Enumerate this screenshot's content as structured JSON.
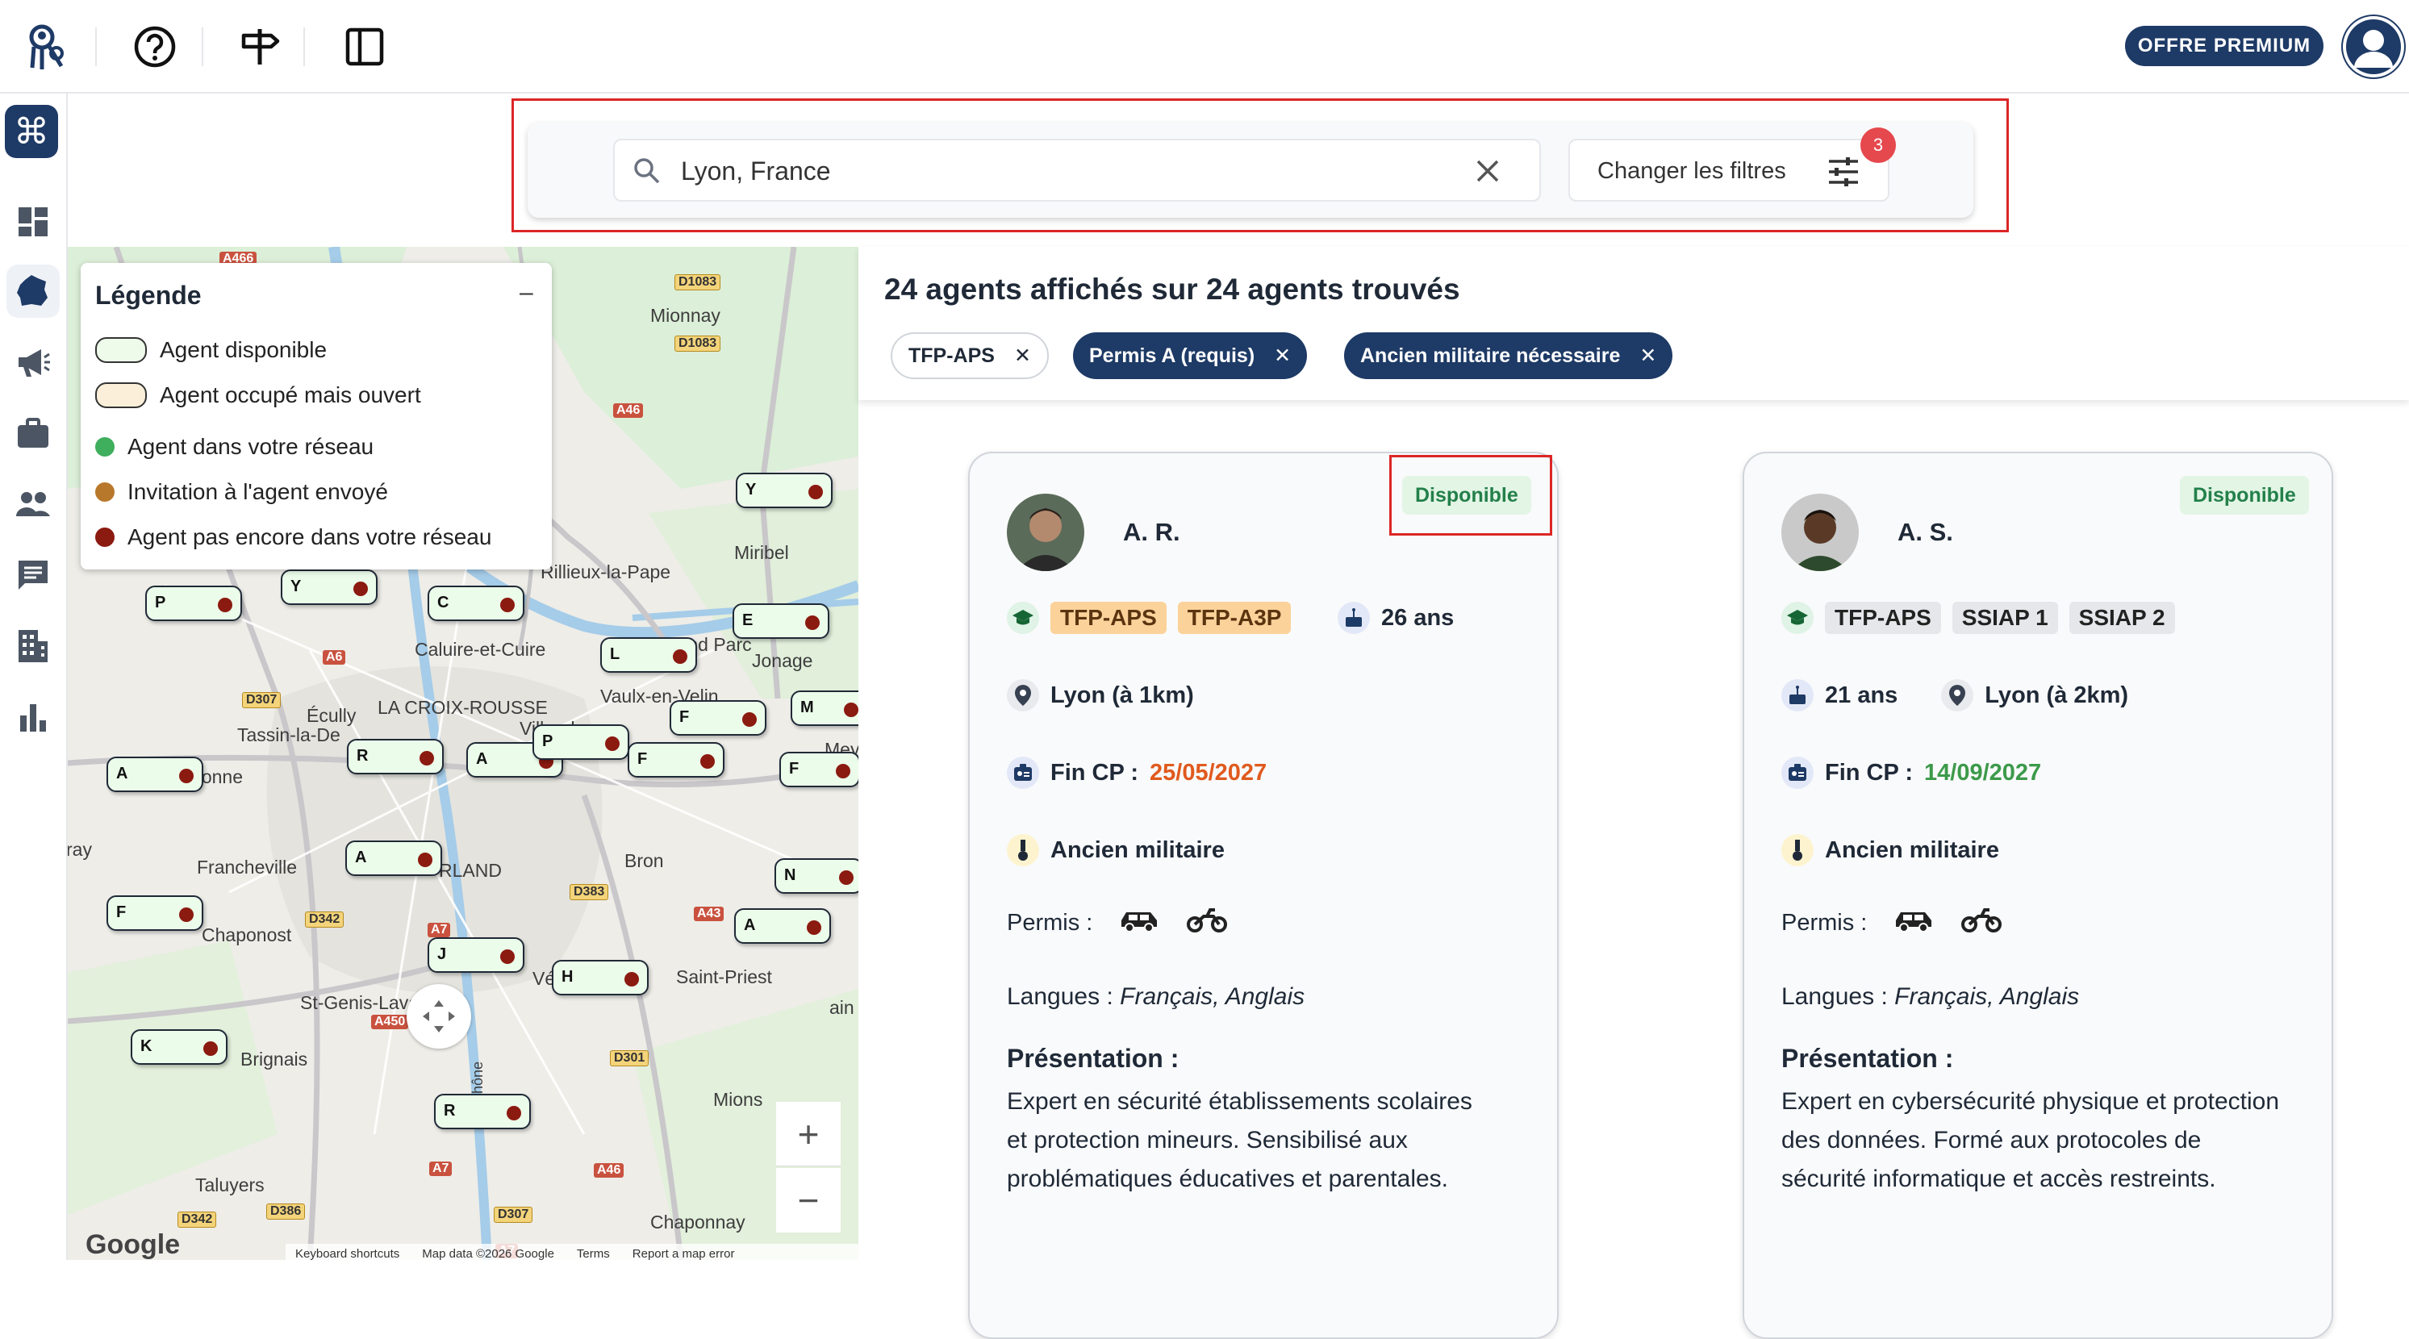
{
  "topbar": {
    "premium_label": "OFFRE PREMIUM"
  },
  "search": {
    "value": "Lyon, France",
    "filter_label": "Changer les filtres",
    "filter_count": "3"
  },
  "legend": {
    "title": "Légende",
    "collapse": "–",
    "items": [
      {
        "label": "Agent disponible",
        "color": "#eefbea"
      },
      {
        "label": "Agent occupé mais ouvert",
        "color": "#fcefd9"
      },
      {
        "label": "Agent dans votre réseau",
        "color": "#3fae5d"
      },
      {
        "label": "Invitation à l'agent envoyé",
        "color": "#b8782b"
      },
      {
        "label": "Agent pas encore dans votre réseau",
        "color": "#8b1a10"
      }
    ]
  },
  "map": {
    "places": [
      "Mionnay",
      "Miribel",
      "Rillieux-la-Pape",
      "Caluire-et-Cuire",
      "Grand Parc",
      "Jonage",
      "Vaulx-en-Velin",
      "LA CROIX-ROUSSE",
      "Écully",
      "Tassin-la-De",
      "Villeurbanne",
      "Craponne",
      "Bron",
      "Francheville",
      "Chaponost",
      "Saint-Priest",
      "St-Genis-Laval",
      "Brignais",
      "Mions",
      "Taluyers",
      "Chaponnay",
      "ray",
      "Vé",
      "Mey",
      "ain",
      "RLAND",
      "Rhône"
    ],
    "roads": [
      "A466",
      "D1083",
      "D1083",
      "A46",
      "A6",
      "D307",
      "D383",
      "A43",
      "D342",
      "A450",
      "A7",
      "D301",
      "A7",
      "A46",
      "D342",
      "D386",
      "D307",
      "A7"
    ],
    "pins": [
      "Y",
      "P",
      "Y",
      "C",
      "E",
      "L",
      "M",
      "F",
      "R",
      "A",
      "P",
      "F",
      "A",
      "F",
      "A",
      "N",
      "F",
      "A",
      "J",
      "H",
      "K",
      "R"
    ],
    "footer": [
      "Keyboard shortcuts",
      "Map data ©2026 Google",
      "Terms",
      "Report a map error"
    ],
    "google": "Google",
    "zoom_in": "+",
    "zoom_out": "−"
  },
  "results": {
    "title": "24 agents affichés sur 24 agents trouvés",
    "chips": [
      "TFP-APS",
      "Permis A (requis)",
      "Ancien militaire nécessaire"
    ],
    "chip_close": "✕"
  },
  "cards": [
    {
      "status": "Disponible",
      "name": "A. R.",
      "quals": [
        "TFP-APS",
        "TFP-A3P"
      ],
      "age": "26 ans",
      "location": "Lyon (à 1km)",
      "fin_cp_label": "Fin CP :",
      "fin_cp_date": "25/05/2027",
      "fin_cp_color": "#e05a1e",
      "military": "Ancien militaire",
      "permis_label": "Permis :",
      "langues_label": "Langues :",
      "langues": "Français, Anglais",
      "presentation_title": "Présentation :",
      "presentation": "Expert en sécurité établissements scolaires et protection mineurs. Sensibilisé aux problématiques éducatives et parentales."
    },
    {
      "status": "Disponible",
      "name": "A. S.",
      "quals": [
        "TFP-APS",
        "SSIAP 1",
        "SSIAP 2"
      ],
      "age": "21 ans",
      "location": "Lyon (à 2km)",
      "fin_cp_label": "Fin CP :",
      "fin_cp_date": "14/09/2027",
      "fin_cp_color": "#3c9a4a",
      "military": "Ancien militaire",
      "permis_label": "Permis :",
      "langues_label": "Langues :",
      "langues": "Français, Anglais",
      "presentation_title": "Présentation :",
      "presentation": "Expert en cybersécurité physique et protection des données. Formé aux protocoles de sécurité informatique et accès restreints."
    }
  ]
}
